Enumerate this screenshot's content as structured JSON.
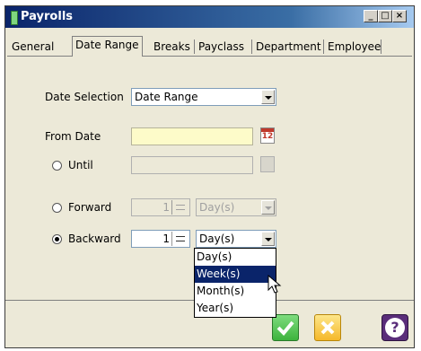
{
  "window": {
    "title": "Payrolls",
    "min": "_",
    "max": "□",
    "close": "×"
  },
  "tabs": [
    "General",
    "Date Range",
    "Breaks",
    "Payclass",
    "Department",
    "Employee"
  ],
  "form": {
    "date_selection_label": "Date Selection",
    "date_selection_value": "Date Range",
    "from_date_label": "From Date",
    "until_label": "Until",
    "forward_label": "Forward",
    "forward_value": "1",
    "forward_unit": "Day(s)",
    "backward_label": "Backward",
    "backward_value": "1",
    "backward_unit": "Day(s)"
  },
  "dropdown": {
    "options": [
      "Day(s)",
      "Week(s)",
      "Month(s)",
      "Year(s)"
    ],
    "highlighted": "Week(s)"
  },
  "calendar_glyph": "12",
  "help_glyph": "?",
  "colors": {
    "accent_yellow": "#fdfbc9",
    "ok_green": "#3db33d",
    "cancel_orange": "#f5b82a",
    "help_purple": "#5a2d7a"
  }
}
